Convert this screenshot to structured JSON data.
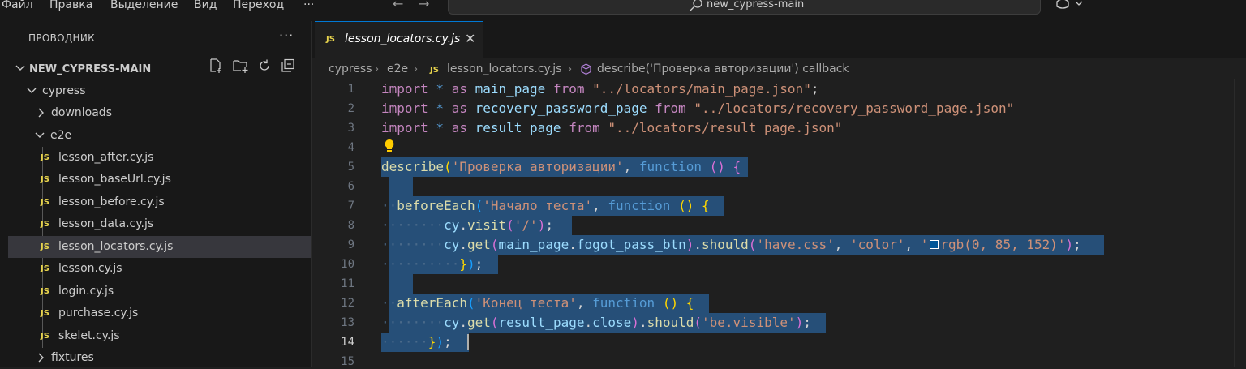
{
  "menu": [
    "Файл",
    "Правка",
    "Выделение",
    "Вид",
    "Переход"
  ],
  "menu_more": "···",
  "command_center": {
    "text": "new_cypress-main"
  },
  "explorer": {
    "title": "ПРОВОДНИК",
    "more": "···",
    "workspace": "NEW_CYPRESS-MAIN",
    "tree": [
      {
        "label": "cypress",
        "type": "folder",
        "expanded": true,
        "level": 1
      },
      {
        "label": "downloads",
        "type": "folder",
        "expanded": false,
        "level": 2
      },
      {
        "label": "e2e",
        "type": "folder",
        "expanded": true,
        "level": 2
      },
      {
        "label": "lesson_after.cy.js",
        "type": "file",
        "level": 3
      },
      {
        "label": "lesson_baseUrl.cy.js",
        "type": "file",
        "level": 3
      },
      {
        "label": "lesson_before.cy.js",
        "type": "file",
        "level": 3
      },
      {
        "label": "lesson_data.cy.js",
        "type": "file",
        "level": 3
      },
      {
        "label": "lesson_locators.cy.js",
        "type": "file",
        "level": 3,
        "selected": true
      },
      {
        "label": "lesson.cy.js",
        "type": "file",
        "level": 3
      },
      {
        "label": "login.cy.js",
        "type": "file",
        "level": 3
      },
      {
        "label": "purchase.cy.js",
        "type": "file",
        "level": 3
      },
      {
        "label": "skelet.cy.js",
        "type": "file",
        "level": 3
      },
      {
        "label": "fixtures",
        "type": "folder",
        "expanded": false,
        "level": 2
      }
    ]
  },
  "js_badge": "JS",
  "tab": {
    "label": "lesson_locators.cy.js",
    "close": "✕"
  },
  "breadcrumbs": {
    "c1": "cypress",
    "c2": "e2e",
    "c3": "lesson_locators.cy.js",
    "c4": "describe('Проверка авторизации') callback"
  },
  "colors": {
    "accent": "#0078d4",
    "selection": "#264f78",
    "js": "#e8d44d",
    "swatch": "#005598"
  },
  "code": {
    "line_numbers": [
      "1",
      "2",
      "3",
      "4",
      "5",
      "6",
      "7",
      "8",
      "9",
      "10",
      "11",
      "12",
      "13",
      "14",
      "15"
    ],
    "current_line": "14",
    "l1": {
      "a": "import",
      "b": " * ",
      "c": "as",
      "d": " main_page ",
      "e": "from",
      "f": " \"../locators/main_page.json\"",
      "g": ";"
    },
    "l2": {
      "a": "import",
      "b": " * ",
      "c": "as",
      "d": " recovery_password_page ",
      "e": "from",
      "f": " \"../locators/recovery_password_page.json\""
    },
    "l3": {
      "a": "import",
      "b": " * ",
      "c": "as",
      "d": " result_page ",
      "e": "from",
      "f": " \"../locators/result_page.json\""
    },
    "l5": {
      "fn": "describe",
      "p": "(",
      "s": "'Проверка авторизации'",
      "c": ", ",
      "kw": "function",
      "sp": " ",
      "p2o": "(",
      "p2c": ")",
      "sp2": " ",
      "b": "{"
    },
    "l7": {
      "ws": "··",
      "fn": "beforeEach",
      "p": "(",
      "s": "'Начало теста'",
      "c": ", ",
      "kw": "function",
      "sp": " ",
      "p2o": "(",
      "p2c": ")",
      "sp2": " ",
      "b": "{"
    },
    "l8": {
      "ws": "········",
      "id": "cy",
      "dot": ".",
      "fn": "visit",
      "p": "(",
      "s": "'/'",
      "pc": ")",
      "semi": ";"
    },
    "l9": {
      "ws": "········",
      "id": "cy",
      "dot": ".",
      "fn": "get",
      "p": "(",
      "id2": "main_page",
      "dot2": ".",
      "id3": "fogot_pass_btn",
      "pc": ")",
      "dot3": ".",
      "fn2": "should",
      "p2": "(",
      "s1": "'have.css'",
      "c1": ", ",
      "s2": "'color'",
      "c2": ", ",
      "s3a": "'",
      "s3b": "rgb(0, 85, 152)'",
      "pc2": ")",
      "semi": ";"
    },
    "l10": {
      "ws": "··········",
      "b": "}",
      "p": ")",
      "semi": ";"
    },
    "l12": {
      "ws": "··",
      "fn": "afterEach",
      "p": "(",
      "s": "'Конец теста'",
      "c": ", ",
      "kw": "function",
      "sp": " ",
      "p2o": "(",
      "p2c": ")",
      "sp2": " ",
      "b": "{"
    },
    "l13": {
      "ws": "········",
      "id": "cy",
      "dot": ".",
      "fn": "get",
      "p": "(",
      "id2": "result_page",
      "dot2": ".",
      "id3": "close",
      "pc": ")",
      "dot3": ".",
      "fn2": "should",
      "p2": "(",
      "s": "'be.visible'",
      "pc2": ")",
      "semi": ";"
    },
    "l14": {
      "ws": "······",
      "b": "}",
      "p": ")",
      "semi": ";"
    }
  }
}
